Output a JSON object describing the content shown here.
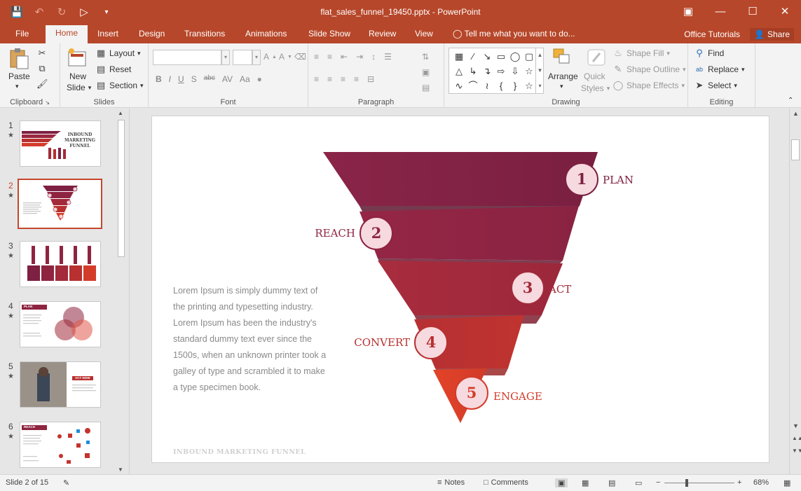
{
  "app": {
    "file_title": "flat_sales_funnel_19450.pptx - PowerPoint",
    "qat_icons": [
      "save-icon",
      "undo-icon",
      "redo-icon",
      "present-icon",
      "customize-icon"
    ]
  },
  "tabs": [
    "File",
    "Home",
    "Insert",
    "Design",
    "Transitions",
    "Animations",
    "Slide Show",
    "Review",
    "View"
  ],
  "active_tab": "Home",
  "tell_me": "Tell me what you want to do...",
  "office_tutorials": "Office Tutorials",
  "share": "Share",
  "ribbon": {
    "clipboard": {
      "label": "Clipboard",
      "paste": "Paste"
    },
    "slides": {
      "label": "Slides",
      "new_slide": "New",
      "new_slide_2": "Slide",
      "layout": "Layout",
      "reset": "Reset",
      "section": "Section"
    },
    "font": {
      "label": "Font",
      "bold": "B",
      "italic": "I",
      "underline": "U",
      "shadow": "S",
      "strike": "abc",
      "spacing": "AV",
      "case": "Aa"
    },
    "paragraph": {
      "label": "Paragraph"
    },
    "drawing": {
      "label": "Drawing",
      "arrange": "Arrange",
      "quick": "Quick",
      "styles": "Styles",
      "shape_fill": "Shape Fill",
      "shape_outline": "Shape Outline",
      "shape_effects": "Shape Effects"
    },
    "editing": {
      "label": "Editing",
      "find": "Find",
      "replace": "Replace",
      "select": "Select"
    }
  },
  "thumbnails": [
    {
      "num": "1",
      "title": "INBOUND MARKETING FUNNEL"
    },
    {
      "num": "2"
    },
    {
      "num": "3"
    },
    {
      "num": "4",
      "tag": "PLAN"
    },
    {
      "num": "5",
      "tag": "ACT NOW"
    },
    {
      "num": "6",
      "tag": "REACH"
    }
  ],
  "slide": {
    "lorem": "Lorem Ipsum is simply dummy text of the printing and typesetting industry. Lorem Ipsum has been the industry's standard dummy text ever since the 1500s, when an unknown printer took a galley of type and scrambled it to make a type specimen book.",
    "footer": "INBOUND MARKETING FUNNEL",
    "stages": [
      {
        "num": "1",
        "label": "PLAN",
        "color": "#7d2041"
      },
      {
        "num": "2",
        "label": "REACH",
        "color": "#8f2440"
      },
      {
        "num": "3",
        "label": "ACT",
        "color": "#a32a3a"
      },
      {
        "num": "4",
        "label": "CONVERT",
        "color": "#b8302f"
      },
      {
        "num": "5",
        "label": "ENGAGE",
        "color": "#d43c2a"
      }
    ]
  },
  "status": {
    "slide_of": "Slide 2 of 15",
    "notes": "Notes",
    "comments": "Comments",
    "zoom": "68%"
  },
  "colors": {
    "accent": "#b7472a"
  }
}
